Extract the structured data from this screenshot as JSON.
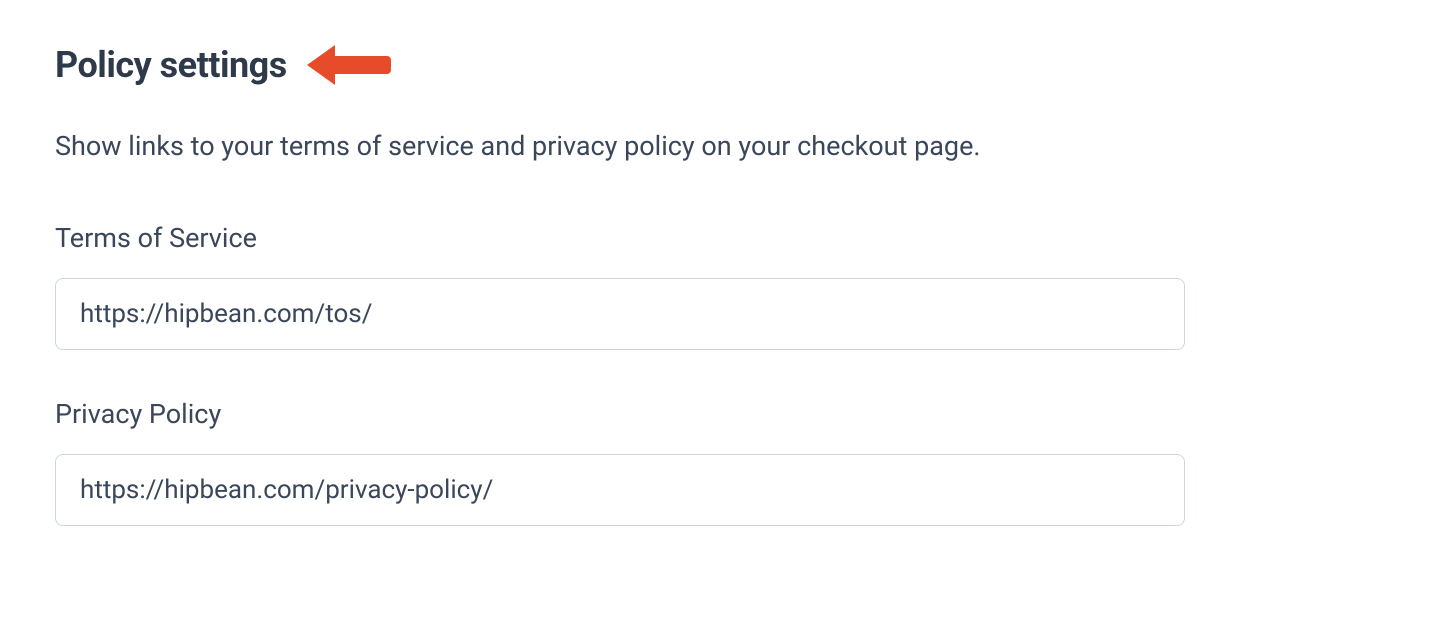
{
  "header": {
    "title": "Policy settings",
    "arrow_icon": "arrow-left-icon"
  },
  "description": "Show links to your terms of service and privacy policy on your checkout page.",
  "fields": {
    "tos": {
      "label": "Terms of Service",
      "value": "https://hipbean.com/tos/"
    },
    "privacy": {
      "label": "Privacy Policy",
      "value": "https://hipbean.com/privacy-policy/"
    }
  },
  "colors": {
    "heading": "#2e3a4a",
    "body": "#3a475a",
    "border": "#cbd6e2",
    "arrow": "#e74c2a"
  }
}
